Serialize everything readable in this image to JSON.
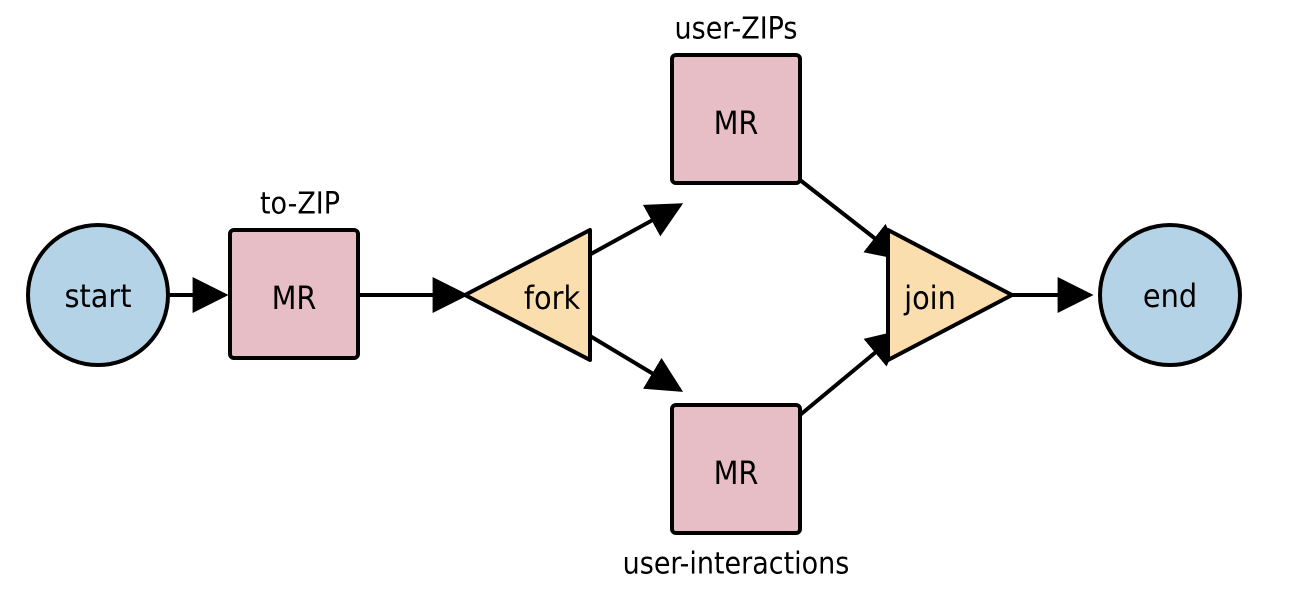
{
  "nodes": {
    "start": {
      "label": "start"
    },
    "toZip": {
      "label": "MR",
      "caption": "to-ZIP"
    },
    "fork": {
      "label": "fork"
    },
    "userZips": {
      "label": "MR",
      "caption": "user-ZIPs"
    },
    "userInt": {
      "label": "MR",
      "caption": "user-interactions"
    },
    "join": {
      "label": "join"
    },
    "end": {
      "label": "end"
    }
  },
  "colors": {
    "circleFill": "#b5d3e7",
    "rectFill": "#e8bec6",
    "triangleFill": "#fbdeae",
    "stroke": "#000000"
  }
}
